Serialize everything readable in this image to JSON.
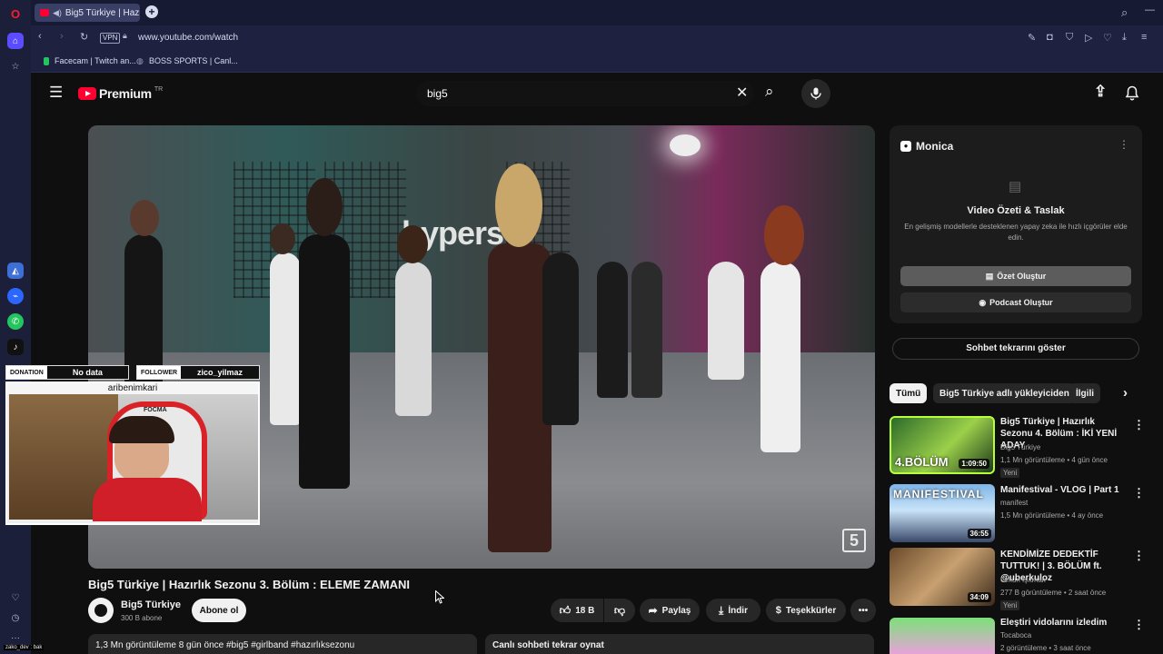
{
  "browser": {
    "tab_title": "Big5 Türkiye | Hazırlık",
    "vpn_label": "VPN",
    "url": "www.youtube.com/watch",
    "bookmarks": [
      "Facecam | Twitch an...",
      "BOSS SPORTS | Canl..."
    ]
  },
  "header": {
    "logo_text": "Premium",
    "region": "TR",
    "search_value": "big5"
  },
  "video": {
    "title": "Big5 Türkiye | Hazırlık Sezonu 3. Bölüm : ELEME ZAMANI",
    "watermark": "5",
    "wall_text": "hypers"
  },
  "overlay": {
    "donation_label": "DONATION",
    "donation_value": "No data",
    "follower_label": "FOLLOWER",
    "follower_value": "zico_yilmaz",
    "cam_caption": "aribenimkari",
    "chair_brand": "FOCMA"
  },
  "channel": {
    "name": "Big5 Türkiye",
    "subs": "300 B abone",
    "subscribe": "Abone ol"
  },
  "actions": {
    "likes": "18 B",
    "share": "Paylaş",
    "download": "İndir",
    "thanks": "Teşekkürler",
    "more": "•••"
  },
  "description": "1,3 Mn görüntüleme  8 gün önce  #big5 #girlband #hazırlıksezonu",
  "chat_replay": "Canlı sohbeti tekrar oynat",
  "monica": {
    "brand": "Monica",
    "heading": "Video Özeti & Taslak",
    "desc": "En gelişmiş modellerle desteklenen yapay zeka ile hızlı içgörüler elde edin.",
    "summary_btn": "Özet Oluştur",
    "podcast_btn": "Podcast Oluştur"
  },
  "chat_toggle": "Sohbet tekrarını göster",
  "chips": [
    "Tümü",
    "Big5 Türkiye adlı yükleyiciden",
    "İlgili"
  ],
  "recommendations": [
    {
      "title": "Big5 Türkiye | Hazırlık Sezonu 4. Bölüm : İKİ YENİ ADAY",
      "channel": "Big5 Türkiye",
      "meta": "1,1 Mn görüntüleme • 4 gün önce",
      "badge": "Yeni",
      "duration": "1:09:50",
      "thumb_text": "4.BÖLÜM"
    },
    {
      "title": "Manifestival - VLOG | Part 1",
      "channel": "manifest",
      "meta": "1,5 Mn görüntüleme • 4 ay önce",
      "badge": "",
      "duration": "36:55",
      "thumb_text": "MANIFESTIVAL"
    },
    {
      "title": "KENDİMİZE DEDEKTİF TUTTUK! | 3. BÖLÜM ft. @uberkuloz",
      "channel": "Orkun Işıtmak",
      "meta": "277 B görüntüleme • 2 saat önce",
      "badge": "Yeni",
      "duration": "34:09",
      "thumb_text": ""
    },
    {
      "title": "Eleştiri vidolarını izledim",
      "channel": "Tocaboca",
      "meta": "2 görüntüleme • 3 saat önce",
      "badge": "",
      "duration": "",
      "thumb_text": ""
    }
  ],
  "status_text": "zako_dev : bak",
  "colors": {
    "brand_red": "#ff0033",
    "bg": "#0f0f0f",
    "surface": "#272727",
    "browser_sidebar": "#1c1f3a"
  }
}
